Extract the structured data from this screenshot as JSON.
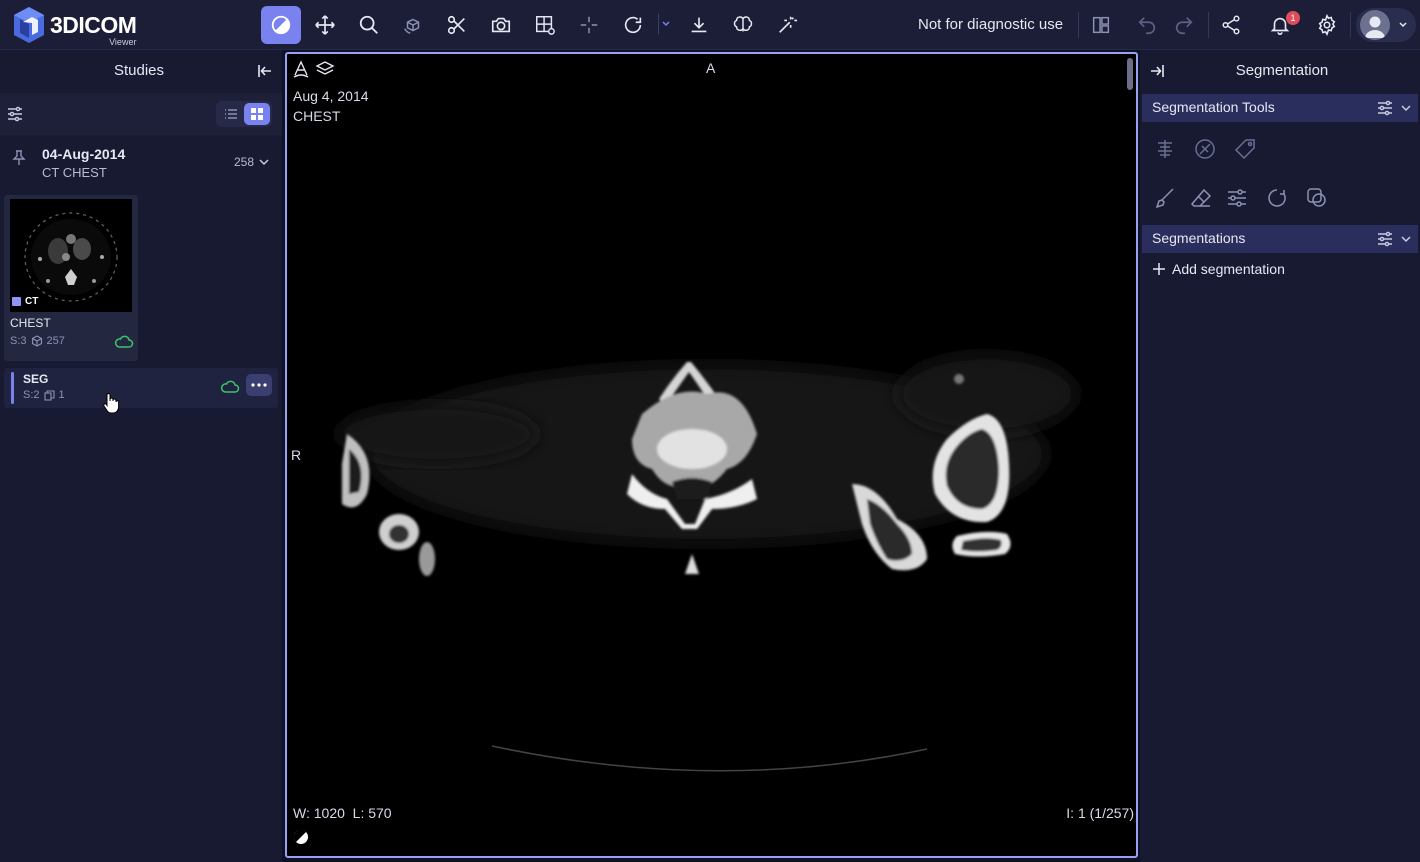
{
  "app": {
    "logo_text": "3DICOM",
    "logo_sub": "Viewer",
    "disclaimer": "Not for diagnostic use",
    "notification_count": "1"
  },
  "toolbar": {
    "tools": [
      {
        "name": "window-level",
        "icon": "contrast-icon",
        "active": true
      },
      {
        "name": "pan",
        "icon": "move-icon"
      },
      {
        "name": "zoom",
        "icon": "search-icon"
      },
      {
        "name": "rotate-3d",
        "icon": "rotate-3d-icon"
      },
      {
        "name": "cut",
        "icon": "scissors-icon"
      },
      {
        "name": "capture",
        "icon": "camera-icon"
      },
      {
        "name": "layout",
        "icon": "grid-settings-icon"
      },
      {
        "name": "crosshair",
        "icon": "crosshair-icon"
      },
      {
        "name": "rotate",
        "icon": "rotate-icon"
      },
      {
        "name": "download",
        "icon": "download-icon"
      },
      {
        "name": "brain",
        "icon": "brain-icon"
      },
      {
        "name": "magic",
        "icon": "magic-wand-icon"
      }
    ]
  },
  "left_panel": {
    "title": "Studies",
    "study": {
      "date": "04-Aug-2014",
      "description": "CT CHEST",
      "count": "258"
    },
    "series": [
      {
        "modality": "CT",
        "name": "CHEST",
        "series_no": "S:3",
        "images": "257"
      }
    ],
    "seg_series": {
      "name": "SEG",
      "series_no": "S:2",
      "count": "1"
    }
  },
  "viewer": {
    "date": "Aug 4, 2014",
    "description": "CHEST",
    "orientation_top": "A",
    "orientation_left": "R",
    "window": "W: 1020",
    "level": "L: 570",
    "index": "I: 1 (1/257)"
  },
  "right_panel": {
    "title": "Segmentation",
    "tools_header": "Segmentation Tools",
    "segmentations_header": "Segmentations",
    "add_label": "Add segmentation"
  },
  "colors": {
    "accent": "#7a82f0",
    "topbar": "#1b1e36",
    "panel": "#171a30",
    "section_header": "#2a2e5c",
    "cloud_green": "#3ac46b"
  }
}
